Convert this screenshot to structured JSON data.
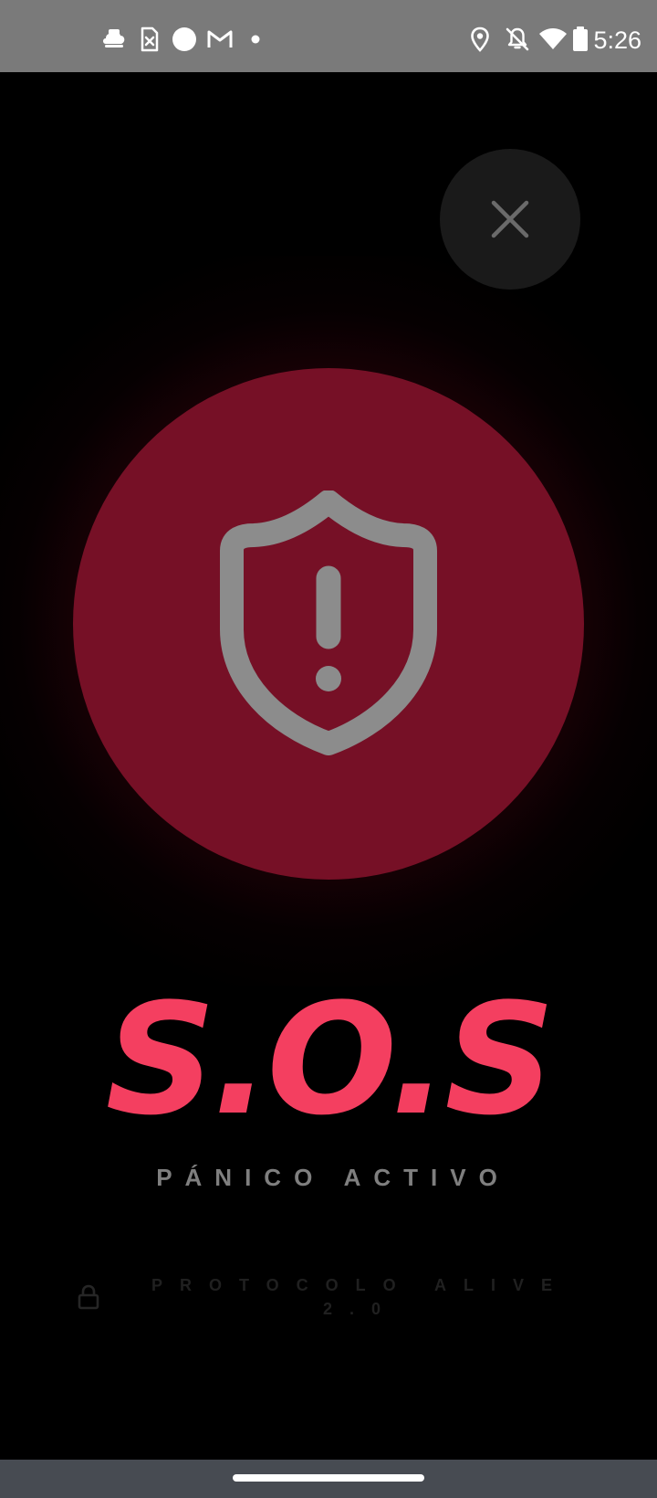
{
  "status_bar": {
    "time": "5:26",
    "left_icons": [
      "cloud-hat-icon",
      "sim-card-x-icon",
      "circle-icon",
      "gmail-icon",
      "dot-icon"
    ],
    "right_icons": [
      "location-icon",
      "bell-off-icon",
      "wifi-icon",
      "battery-icon"
    ]
  },
  "close_button": {
    "icon": "close-icon"
  },
  "panic_button": {
    "icon": "shield-alert-icon",
    "color": "#761026"
  },
  "sos": {
    "title": "S.O.S",
    "subtitle": "PÁNICO ACTIVO",
    "color": "#f43f60"
  },
  "footer": {
    "protocol_label": "PROTOCOLO ALIVE 2.0",
    "icon": "lock-icon"
  },
  "colors": {
    "background": "#000000",
    "status_bar": "#7a7a7a",
    "nav_bar": "#474b52",
    "icon_gray": "#8a8a8a"
  }
}
